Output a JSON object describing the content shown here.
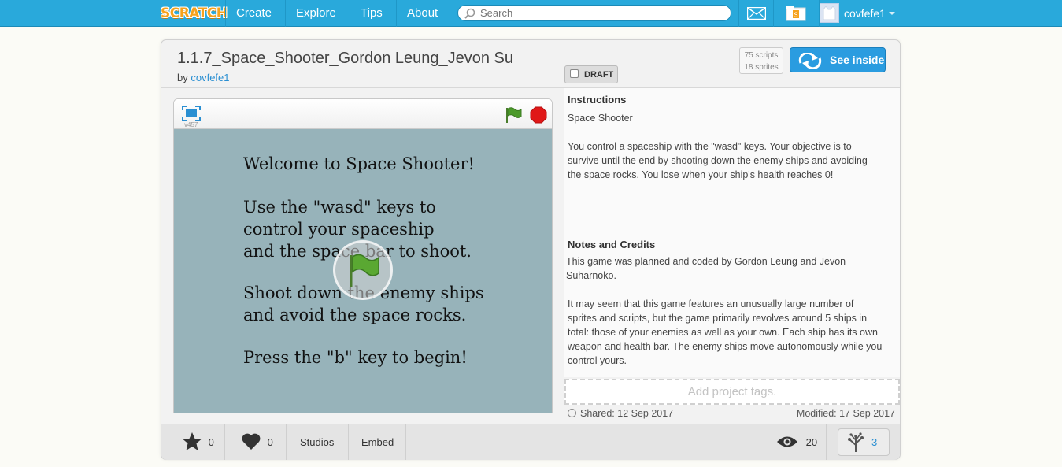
{
  "nav": {
    "logo": "SCRATCH",
    "links": [
      "Create",
      "Explore",
      "Tips",
      "About"
    ],
    "search_placeholder": "Search",
    "username": "covfefe1"
  },
  "project": {
    "title": "1.1.7_Space_Shooter_Gordon Leung_Jevon Su",
    "by_prefix": "by",
    "author": "covfefe1",
    "draft_label": "DRAFT",
    "scripts_count": "75 scripts",
    "sprites_count": "18 sprites",
    "see_inside_label": "See inside"
  },
  "player": {
    "version": "v457",
    "stage_lines": [
      "Welcome to Space Shooter!",
      "Use the \"wasd\" keys to\ncontrol your spaceship\nand the space bar to shoot.",
      "Shoot down the enemy ships\nand avoid the space rocks.",
      "Press the \"b\" key to begin!"
    ]
  },
  "instructions": {
    "heading": "Instructions",
    "line1": "Space Shooter",
    "para": "You control a spaceship with the \"wasd\" keys. Your objective is to survive until the end by shooting down the enemy ships and avoiding the space rocks. You lose when your ship's health reaches 0!"
  },
  "notes": {
    "heading": "Notes and Credits",
    "para1": "This game was planned and coded by Gordon Leung and Jevon Suharnoko.",
    "para2": "It may seem that this game features an unusually large number of sprites and scripts, but the game primarily revolves around 5 ships in total: those of your enemies as well as your own. Each ship has its own weapon and health bar. The enemy ships move autonomously while you control yours."
  },
  "tags_placeholder": "Add project tags.",
  "shared": "Shared: 12 Sep 2017",
  "modified": "Modified: 17 Sep 2017",
  "stats": {
    "favorites": "0",
    "loves": "0",
    "studios_label": "Studios",
    "embed_label": "Embed",
    "views": "20",
    "remixes": "3"
  }
}
